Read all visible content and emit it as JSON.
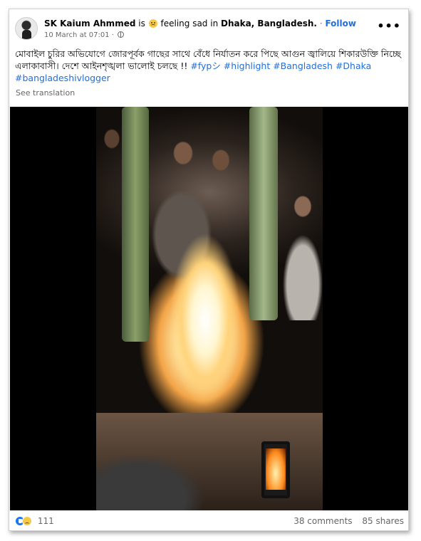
{
  "post": {
    "author": "SK Kaium Ahmmed",
    "is_word": "is",
    "feeling_text": "feeling sad in",
    "location": "Dhaka, Bangladesh.",
    "separator": "·",
    "follow_label": "Follow",
    "timestamp": "10 March at 07:01 ·",
    "more_label": "•••",
    "text": "মোবাইল চুরির অভিযোগে জোরপূর্বক গাছের সাথে বেঁধে নির্যাতন করে পিছে আগুন জ্বালিয়ে শিকারউক্তি নিচ্ছে এলাকাবাসী। দেশে আইনশৃঙ্খলা ভালোই চলছে !! ",
    "hashtags": "#fypシ #highlight #Bangladesh #Dhaka #bangladeshivlogger",
    "see_translation": "See translation"
  },
  "footer": {
    "reaction_count": "111",
    "comments": "38 comments",
    "shares": "85 shares"
  },
  "colors": {
    "link": "#216fdb",
    "secondary_text": "#65676b",
    "like_blue": "#1877f2",
    "sad_yellow": "#f7c948"
  },
  "icons": [
    "avatar",
    "sad-emoji-icon",
    "globe-icon",
    "more-options-icon",
    "like-reaction-icon",
    "sad-reaction-icon"
  ]
}
